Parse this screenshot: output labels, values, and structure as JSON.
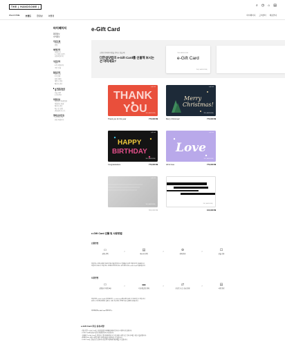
{
  "header": {
    "logo": "THE | HANDSOME |",
    "gnb": [
      "WeLCOME",
      "브랜드",
      "한정상",
      "아울렛"
    ],
    "util": [
      "마이페이지",
      "고객센터",
      "매장안내"
    ],
    "icons": [
      "search-icon",
      "user-icon",
      "bag-icon",
      "menu-icon"
    ]
  },
  "sidebar": {
    "title": "마이페이지",
    "top_items": [
      "회원정보",
      "나의정보"
    ],
    "sections": [
      {
        "title": "주문조회",
        "items": [
          "주문내역",
          "반품"
        ]
      },
      {
        "title": "혜택관리",
        "items": [
          "마일리지",
          "e-스마일 포인트",
          "한섬마일리지"
        ]
      },
      {
        "title": "쿠폰관리",
        "items": [
          "쿠폰",
          "e-식 마일리지",
          "쿠폰 등록"
        ]
      },
      {
        "title": "활동관리",
        "items": [
          "상품 리뷰",
          "1:1 문의",
          "상품 Q&A",
          "재입고 알림",
          "배송지 관리"
        ]
      },
      {
        "title": "e-Gift Card",
        "active": true,
        "items": [
          "내 e-Gift Card",
          "선물 내역",
          "e-voucher"
        ]
      },
      {
        "title": "회원정보",
        "items": [
          "회원정보 변경/탈퇴",
          "비밀번호 변경",
          "배송지 관리",
          "최근 본 상품",
          "관심상품 리스트"
        ]
      },
      {
        "title": "멤버십/쿠폰등",
        "items": [
          "e-Smile Pay",
          "한섬 마일리지"
        ]
      }
    ]
  },
  "main": {
    "title": "e-Gift Card",
    "banner": {
      "sub": "소중한 분에게 마음을 전하고 싶을 때",
      "headline": "더한섬닷컴의 e-Gift Card를 선물해 보시는 건 어떠세요?",
      "card_small": "THE HANDSOME",
      "card_big": "e-Gift Card",
      "card_mini": "THE | HANDSOME |"
    },
    "cards": [
      {
        "label": "Thank you for this year",
        "price": "770,000 ₩",
        "art": "THANK YOU"
      },
      {
        "label": "Merry Christmas!",
        "price": "770,000 ₩",
        "art": "Merry Christmas!"
      },
      {
        "label": "Congratulations",
        "price": "770,000 ₩",
        "art": "HAPPY BIRTHDAY"
      },
      {
        "label": "All for love",
        "price": "770,000 ₩",
        "art": "Love"
      },
      {
        "label": "",
        "price": "500,000 ₩",
        "art": ""
      },
      {
        "label": "",
        "price": "100,000 ₩",
        "art": ""
      }
    ],
    "card_tag": "e-gift card",
    "card_brand": "THE | HANDSOME |"
  },
  "howto": {
    "title": "e-Gift Card 선물 및 사용방법",
    "gift_title": "선물방법",
    "gift_steps": [
      "상품 선택",
      "메시지 입력",
      "결제 완료",
      "선물 전송"
    ],
    "gift_note_1": "선물 받는 분의 휴대폰 번호와 메시지를 입력하시고 결제를 하시면 선물하기가 완료됩니다.",
    "gift_note_2": "선물하기 완료 후 선물 받는 분에게 카카오톡 또는 문자 메시지로 e-Gift Card가 발송됩니다.",
    "use_title": "사용방법",
    "use_steps": [
      "상품권 수령(등록)",
      "더한섬닷컴 결제",
      "포인트 또는 현금 전환",
      "사용 완료"
    ],
    "use_note_1": "선물 받은 e-Gift Card는 마이페이지 > e-Gift Card 메뉴에서 등록 후 사용하실 수 있습니다.",
    "use_note_2": "등록 후 더한섬닷컴에서 결제 시 사용 가능하며, 잔액은 다음 결제에 사용됩니다.",
    "use_link": "더한섬닷컴 e-Gift Card 확인하기 >"
  },
  "faq": {
    "title": "e-Gift Card 주요 유의사항",
    "lines": [
      "· 선물 받은 e-Gift Card는 더한섬닷컴 마이페이지에서 등록 후 사용이 가능합니다.",
      "· e-Gift Card의 유효기간은 발행일로부터 5년입니다.",
      "· 구매하신 e-Gift Card는 결제 후 7일 이내에 취소가 가능하며, 사용 또는 등록 후에는 취소가 불가합니다.",
      "· 잔액이 60% 이상 사용된 경우 잔액 환불을 요청하실 수 있습니다.",
      "· e-Gift Card는 현금으로 교환되지 않으며 타인에게 재판매할 수 없습니다."
    ]
  }
}
